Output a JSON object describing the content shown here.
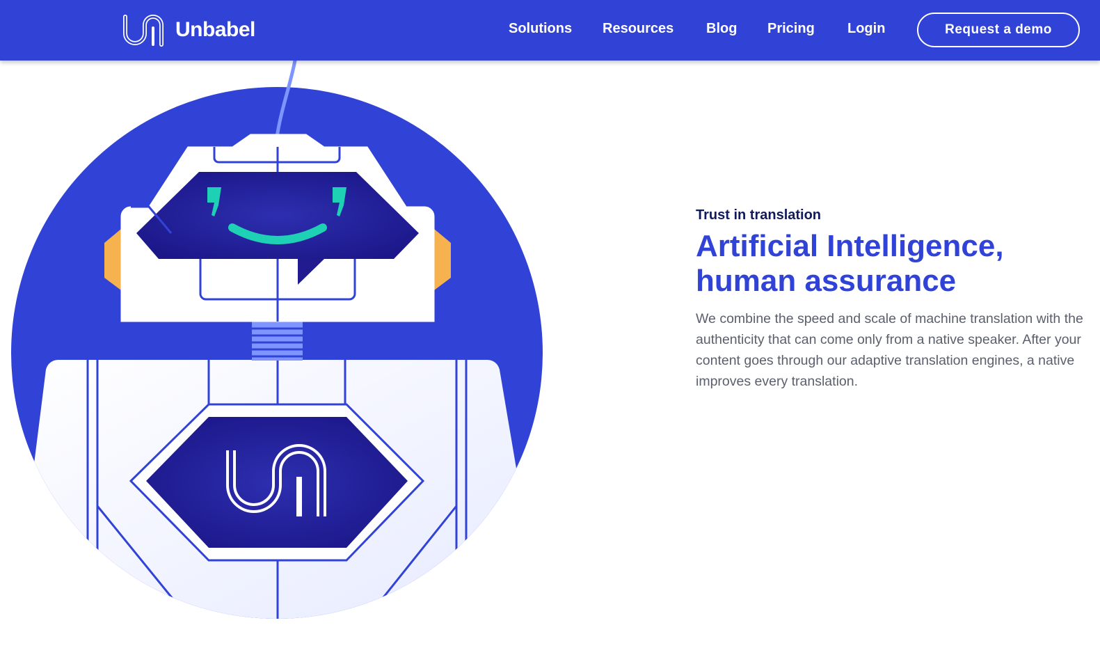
{
  "header": {
    "brand_name": "Unbabel",
    "logo_icon": "unbabel-un-logo-icon",
    "nav": [
      {
        "label": "Solutions"
      },
      {
        "label": "Resources"
      },
      {
        "label": "Blog"
      },
      {
        "label": "Pricing"
      },
      {
        "label": "Login"
      }
    ],
    "cta_label": "Request a demo"
  },
  "hero": {
    "eyebrow": "Trust in translation",
    "headline_line1": "Artificial Intelligence,",
    "headline_line2": "human assurance",
    "body": "We combine the speed and scale of machine translation with the authenticity that can come only from a native speaker. After your content goes through our adaptive translation engines, a native improves every translation.",
    "illustration_icon": "smiling-robot-illustration"
  },
  "colors": {
    "brand_blue": "#3143d6",
    "navy": "#101a5c",
    "screen_indigo": "#221b8f",
    "smile_teal": "#1fd1b4",
    "ear_orange": "#f6b24e",
    "antenna_lilac": "#7e95ff",
    "body_text": "#5b5f6b"
  }
}
